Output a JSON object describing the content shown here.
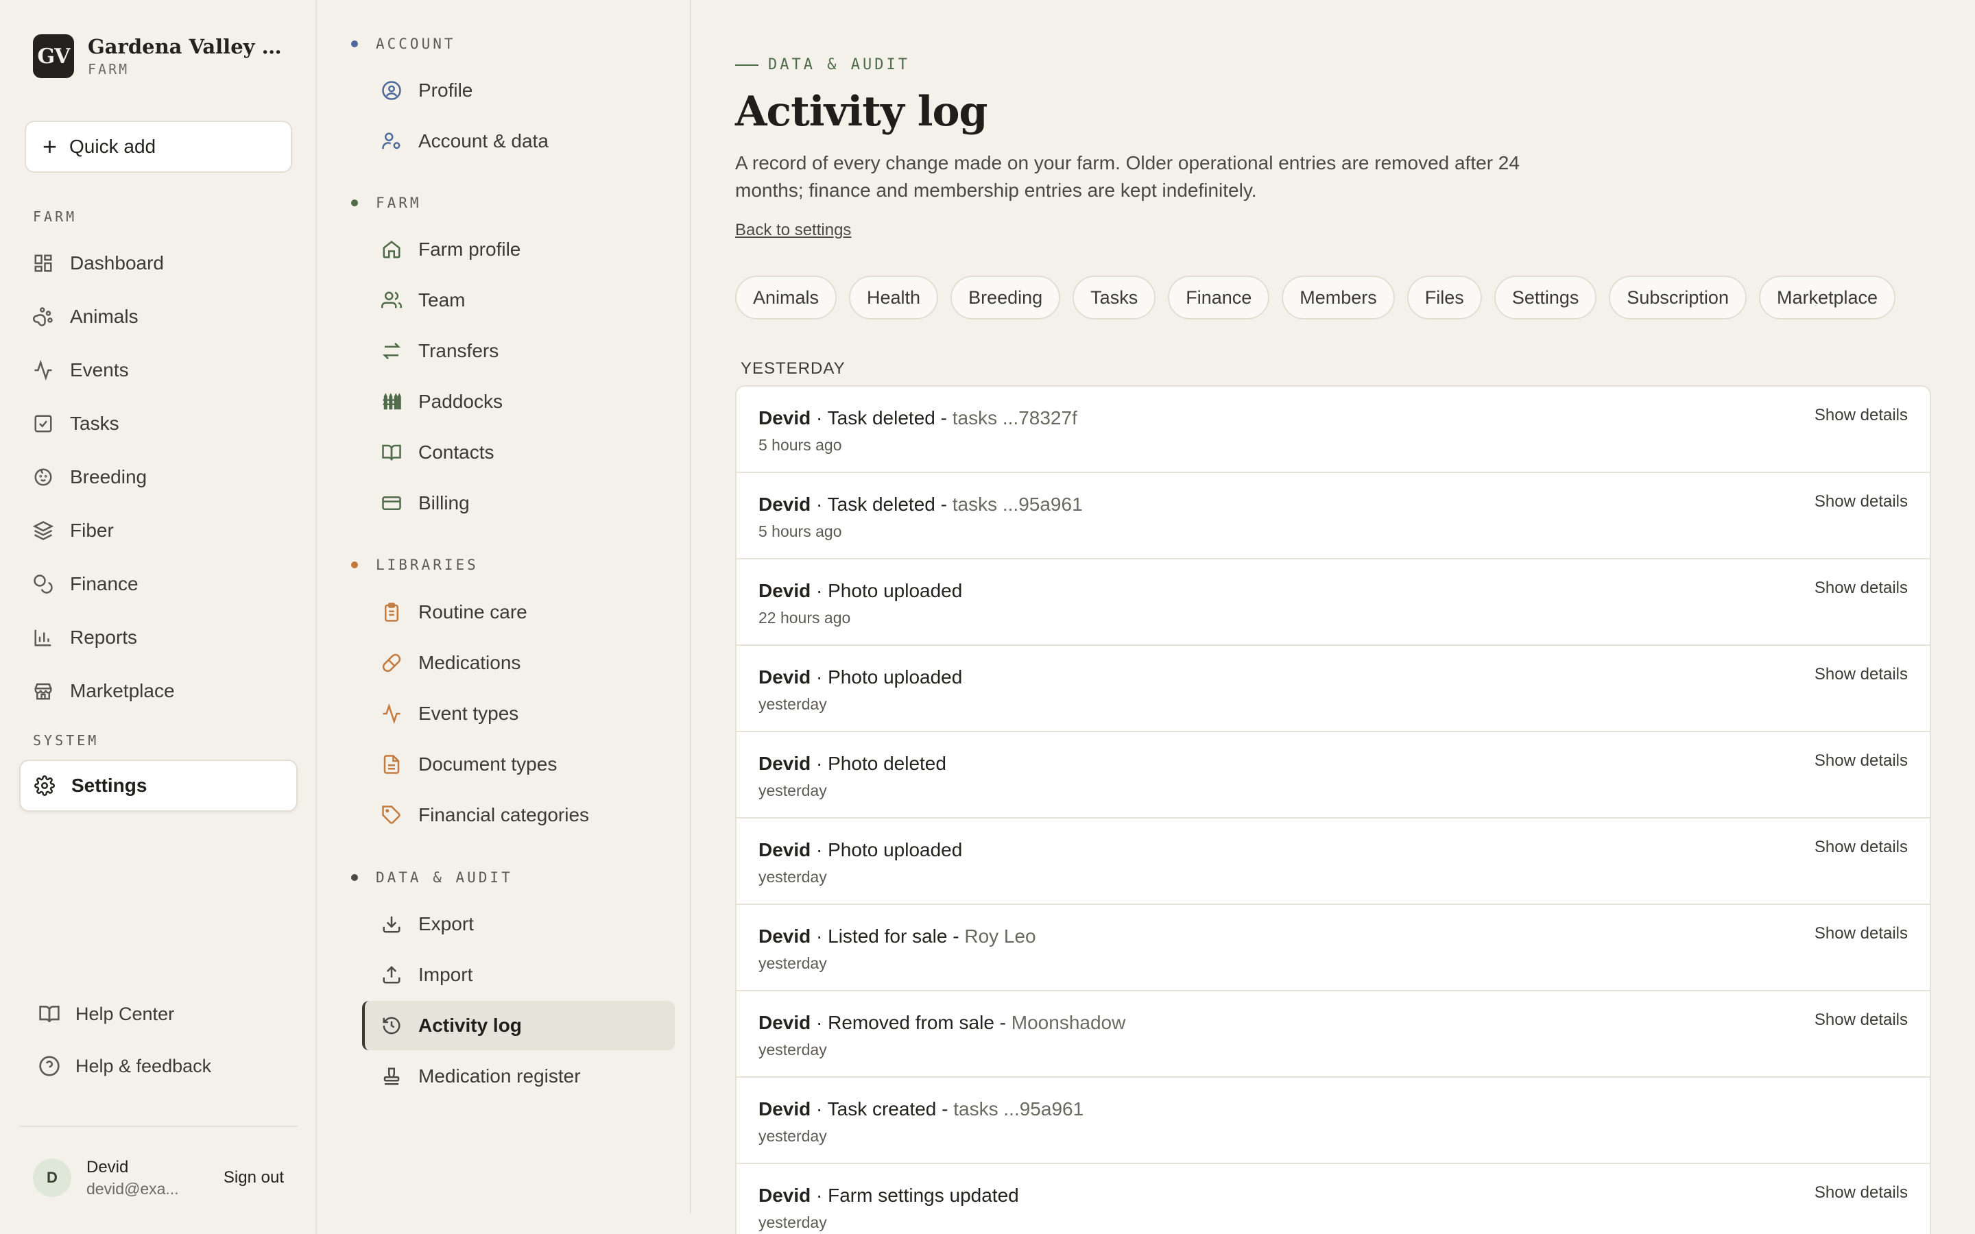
{
  "brand": {
    "initials": "GV",
    "name": "Gardena Valley Alp...",
    "subtitle": "FARM"
  },
  "quick_add": {
    "label": "Quick add"
  },
  "sidebar": {
    "farm_title": "FARM",
    "items": [
      {
        "label": "Dashboard"
      },
      {
        "label": "Animals"
      },
      {
        "label": "Events"
      },
      {
        "label": "Tasks"
      },
      {
        "label": "Breeding"
      },
      {
        "label": "Fiber"
      },
      {
        "label": "Finance"
      },
      {
        "label": "Reports"
      },
      {
        "label": "Marketplace"
      }
    ],
    "system_title": "SYSTEM",
    "settings_label": "Settings",
    "help_center": "Help Center",
    "help_feedback": "Help & feedback"
  },
  "user": {
    "initial": "D",
    "name": "Devid",
    "email": "devid@exa...",
    "sign_out": "Sign out"
  },
  "subnav": {
    "account_title": "ACCOUNT",
    "account": [
      "Profile",
      "Account & data"
    ],
    "farm_title": "FARM",
    "farm": [
      "Farm profile",
      "Team",
      "Transfers",
      "Paddocks",
      "Contacts",
      "Billing"
    ],
    "libraries_title": "LIBRARIES",
    "libraries": [
      "Routine care",
      "Medications",
      "Event types",
      "Document types",
      "Financial categories"
    ],
    "audit_title": "DATA & AUDIT",
    "audit": [
      "Export",
      "Import",
      "Activity log",
      "Medication register"
    ],
    "colors": {
      "account": "#4e6a9a",
      "farm": "#4f6b4a",
      "libraries": "#c27a3e",
      "audit": "#4a4944"
    }
  },
  "main": {
    "eyebrow": "DATA & AUDIT",
    "title": "Activity log",
    "description": "A record of every change made on your farm. Older operational entries are removed after 24 months; finance and membership entries are kept indefinitely.",
    "back_link": "Back to settings",
    "filters": [
      "Animals",
      "Health",
      "Breeding",
      "Tasks",
      "Finance",
      "Members",
      "Files",
      "Settings",
      "Subscription",
      "Marketplace"
    ],
    "group_label": "YESTERDAY",
    "entries": [
      {
        "actor": "Devid",
        "action": " · Task deleted - ",
        "target": "tasks ...78327f",
        "time": "5 hours ago",
        "details": "Show details"
      },
      {
        "actor": "Devid",
        "action": " · Task deleted - ",
        "target": "tasks ...95a961",
        "time": "5 hours ago",
        "details": "Show details"
      },
      {
        "actor": "Devid",
        "action": " · Photo uploaded",
        "target": "",
        "time": "22 hours ago",
        "details": "Show details"
      },
      {
        "actor": "Devid",
        "action": " · Photo uploaded",
        "target": "",
        "time": "yesterday",
        "details": "Show details"
      },
      {
        "actor": "Devid",
        "action": " · Photo deleted",
        "target": "",
        "time": "yesterday",
        "details": "Show details"
      },
      {
        "actor": "Devid",
        "action": " · Photo uploaded",
        "target": "",
        "time": "yesterday",
        "details": "Show details"
      },
      {
        "actor": "Devid",
        "action": " · Listed for sale - ",
        "target": "Roy Leo",
        "time": "yesterday",
        "details": "Show details"
      },
      {
        "actor": "Devid",
        "action": " · Removed from sale - ",
        "target": "Moonshadow",
        "time": "yesterday",
        "details": "Show details"
      },
      {
        "actor": "Devid",
        "action": " · Task created - ",
        "target": "tasks ...95a961",
        "time": "yesterday",
        "details": ""
      },
      {
        "actor": "Devid",
        "action": " · Farm settings updated",
        "target": "",
        "time": "yesterday",
        "details": "Show details"
      }
    ]
  }
}
